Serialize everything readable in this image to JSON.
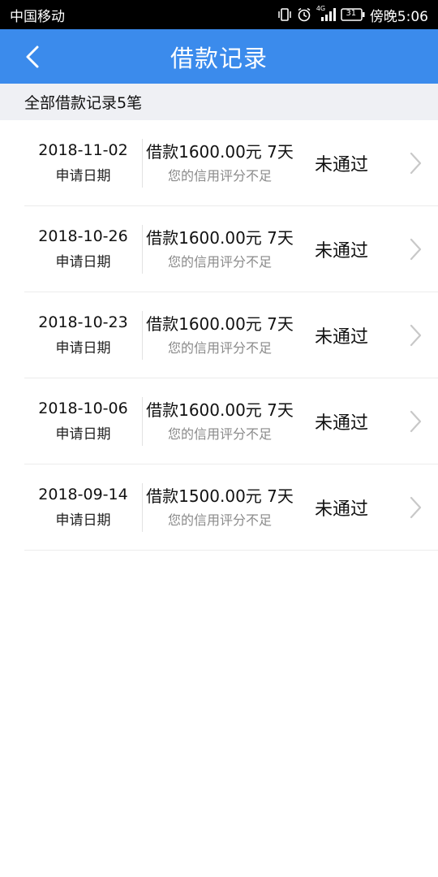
{
  "status_bar": {
    "carrier": "中国移动",
    "network": "4G",
    "battery": "31",
    "time": "傍晚5:06",
    "icons": [
      "vibrate-icon",
      "alarm-icon",
      "signal-icon",
      "battery-icon"
    ]
  },
  "header": {
    "title": "借款记录",
    "back_icon": "chevron-left-icon"
  },
  "summary": {
    "text": "全部借款记录5笔"
  },
  "records": [
    {
      "date": "2018-11-02",
      "date_label": "申请日期",
      "amount": "借款1600.00元 7天",
      "reason": "您的信用评分不足",
      "status": "未通过"
    },
    {
      "date": "2018-10-26",
      "date_label": "申请日期",
      "amount": "借款1600.00元 7天",
      "reason": "您的信用评分不足",
      "status": "未通过"
    },
    {
      "date": "2018-10-23",
      "date_label": "申请日期",
      "amount": "借款1600.00元 7天",
      "reason": "您的信用评分不足",
      "status": "未通过"
    },
    {
      "date": "2018-10-06",
      "date_label": "申请日期",
      "amount": "借款1600.00元 7天",
      "reason": "您的信用评分不足",
      "status": "未通过"
    },
    {
      "date": "2018-09-14",
      "date_label": "申请日期",
      "amount": "借款1500.00元 7天",
      "reason": "您的信用评分不足",
      "status": "未通过"
    }
  ],
  "colors": {
    "header_bg": "#3b8bec",
    "summary_bg": "#eff0f4",
    "reason_text": "#8a8a8a"
  }
}
